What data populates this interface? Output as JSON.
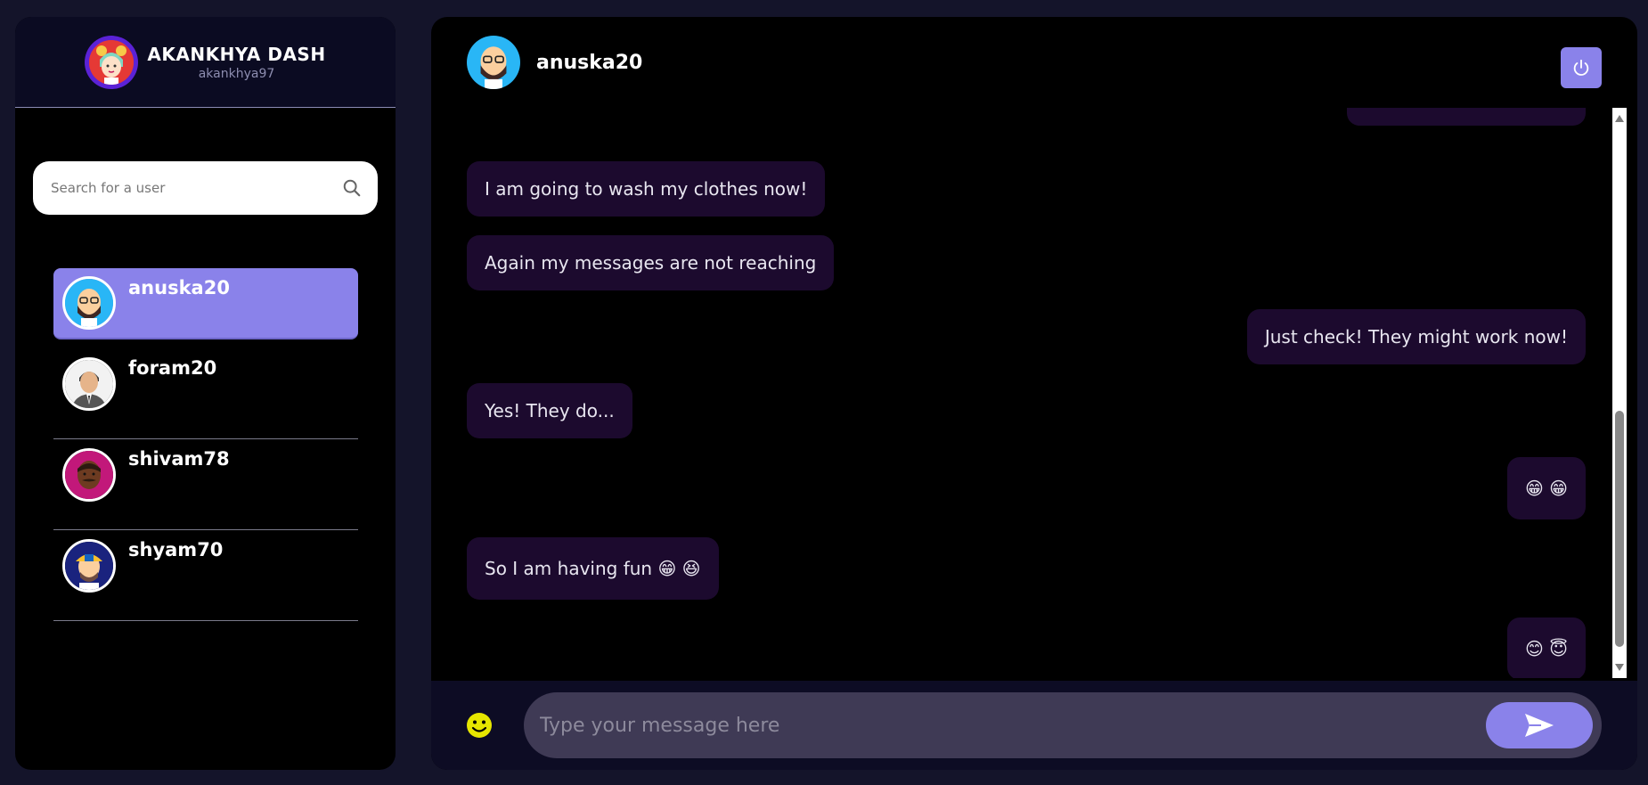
{
  "profile": {
    "name": "AKANKHYA DASH",
    "username": "akankhya97"
  },
  "search": {
    "placeholder": "Search for a user"
  },
  "users": [
    {
      "name": "anuska20",
      "active": true
    },
    {
      "name": "foram20",
      "active": false
    },
    {
      "name": "shivam78",
      "active": false
    },
    {
      "name": "shyam70",
      "active": false
    }
  ],
  "chat": {
    "title": "anuska20",
    "messages": [
      {
        "side": "left",
        "text": "I am going to wash my clothes now!"
      },
      {
        "side": "left",
        "text": "Again my messages are not reaching"
      },
      {
        "side": "right",
        "text": "Just check! They might work now!"
      },
      {
        "side": "left",
        "text": "Yes! They do..."
      },
      {
        "side": "right",
        "text": "😁 😁"
      },
      {
        "side": "left",
        "text": "So I am having fun 😁 😆"
      },
      {
        "side": "right",
        "text": "😊 😇"
      }
    ]
  },
  "composer": {
    "placeholder": "Type your message here"
  },
  "colors": {
    "accent": "#8a82ea",
    "bubble": "#1c0a2e",
    "background": "#14142a"
  }
}
